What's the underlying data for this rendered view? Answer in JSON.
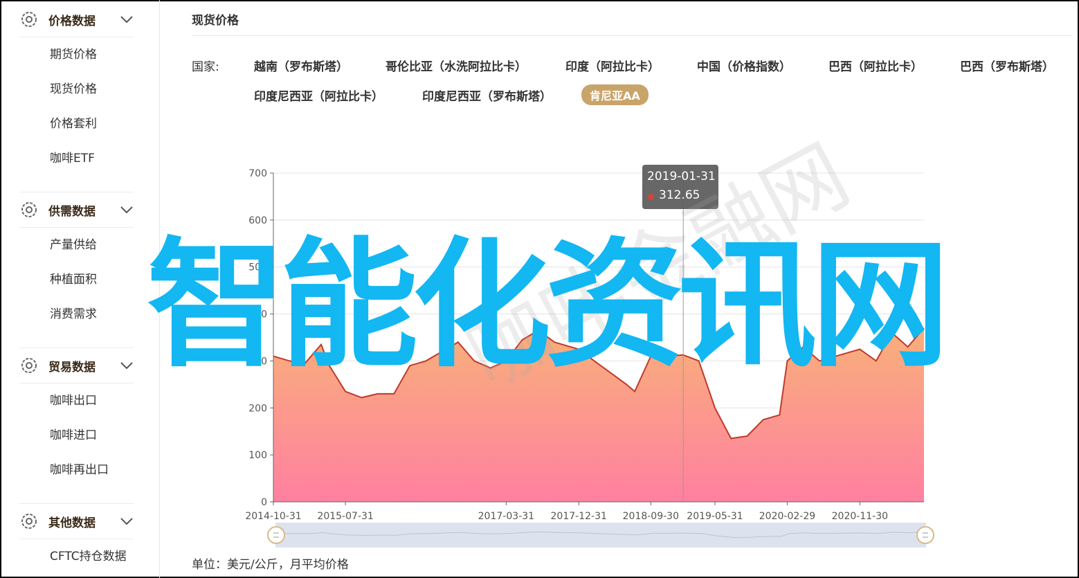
{
  "sidebar": {
    "groups": [
      {
        "title": "价格数据",
        "items": [
          "期货价格",
          "现货价格",
          "价格套利",
          "咖啡ETF"
        ]
      },
      {
        "title": "供需数据",
        "items": [
          "产量供给",
          "种植面积",
          "消费需求"
        ]
      },
      {
        "title": "贸易数据",
        "items": [
          "咖啡出口",
          "咖啡进口",
          "咖啡再出口"
        ]
      },
      {
        "title": "其他数据",
        "items": [
          "CFTC持仓数据"
        ]
      }
    ]
  },
  "main": {
    "title": "现货价格",
    "country_label": "国家:",
    "countries": [
      "越南（罗布斯塔）",
      "哥伦比亚（水洗阿拉比卡）",
      "印度（阿拉比卡）",
      "中国（价格指数）",
      "巴西（阿拉比卡）",
      "巴西（罗布斯塔）",
      "印度尼西亚（阿拉比卡）",
      "印度尼西亚（罗布斯塔）",
      "肯尼亚AA"
    ],
    "active_country": "肯尼亚AA",
    "unit": "单位：美元/公斤，月平均价格"
  },
  "tooltip": {
    "date": "2019-01-31",
    "value": "312.65",
    "dot_color": "#d9413a"
  },
  "watermark": {
    "big": "智能化资讯网",
    "faint": "咖啡金融网"
  },
  "colors": {
    "accent": "#c9a46a",
    "line": "#c0392b",
    "fill_top": "#f8b07a",
    "fill_bottom": "#ff80a0",
    "watermark": "#13b7f2"
  },
  "chart_data": {
    "type": "area",
    "title": "",
    "xlabel": "",
    "ylabel": "",
    "ylim": [
      0,
      700
    ],
    "yticks": [
      0,
      100,
      200,
      300,
      400,
      500,
      600,
      700
    ],
    "xtick_labels": [
      "2014-10-31",
      "2015-07-31",
      "2017-03-31",
      "2017-12-31",
      "2018-09-30",
      "2019-05-31",
      "2020-02-29",
      "2020-11-30"
    ],
    "x": [
      "2014-10-31",
      "2014-12-31",
      "2015-02-28",
      "2015-04-30",
      "2015-05-31",
      "2015-07-31",
      "2015-09-30",
      "2015-11-30",
      "2016-01-31",
      "2016-03-31",
      "2016-05-31",
      "2016-07-31",
      "2016-09-30",
      "2016-11-30",
      "2017-01-31",
      "2017-03-31",
      "2017-05-31",
      "2017-07-31",
      "2017-09-30",
      "2017-12-31",
      "2018-02-28",
      "2018-04-30",
      "2018-06-30",
      "2018-07-31",
      "2018-09-30",
      "2018-11-30",
      "2019-01-31",
      "2019-03-31",
      "2019-05-31",
      "2019-07-31",
      "2019-09-30",
      "2019-11-30",
      "2020-01-31",
      "2020-02-29",
      "2020-04-30",
      "2020-06-30",
      "2020-08-31",
      "2020-11-30",
      "2021-01-31",
      "2021-03-31",
      "2021-05-31",
      "2021-07-31"
    ],
    "series": [
      {
        "name": "",
        "values": [
          310,
          300,
          295,
          335,
          290,
          235,
          222,
          230,
          230,
          290,
          300,
          320,
          340,
          300,
          285,
          300,
          345,
          365,
          340,
          325,
          300,
          275,
          250,
          235,
          310,
          310,
          312.65,
          300,
          200,
          135,
          140,
          175,
          185,
          300,
          330,
          300,
          310,
          325,
          300,
          360,
          330,
          370
        ]
      }
    ],
    "grid": true,
    "legend": "none"
  }
}
